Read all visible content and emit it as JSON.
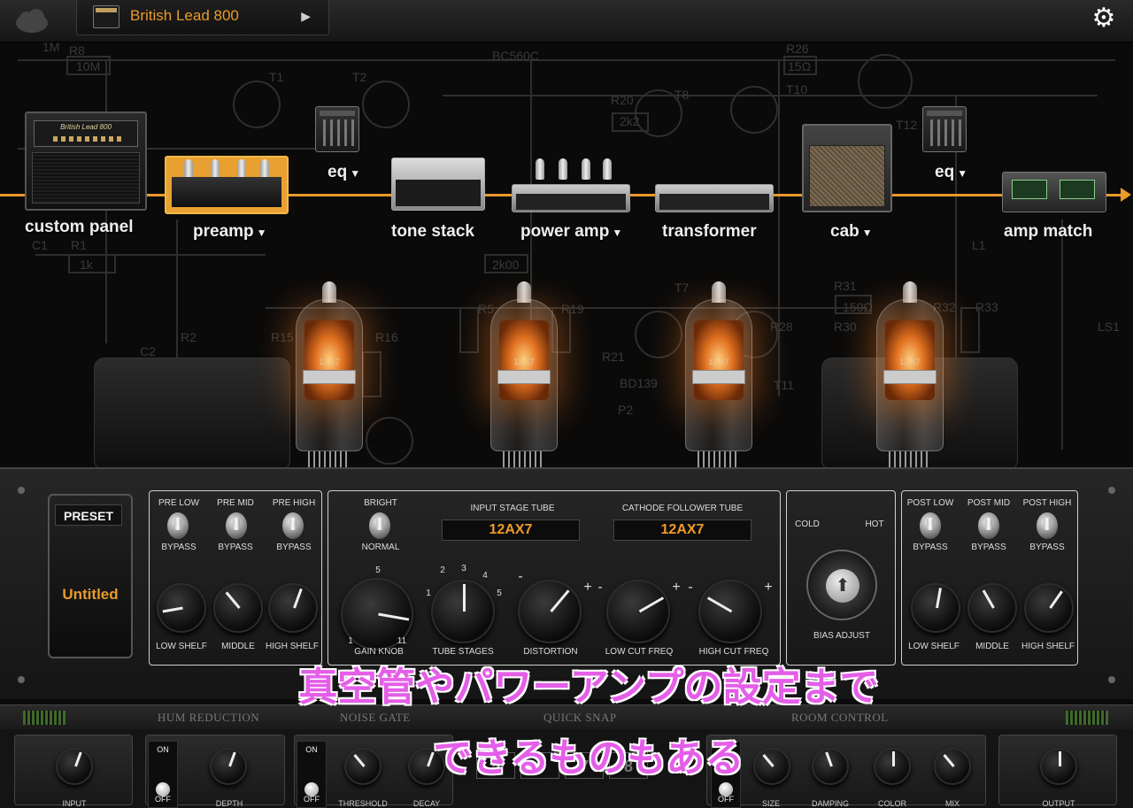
{
  "topbar": {
    "preset_name": "British Lead 800",
    "cloud_icon": "cloud-icon",
    "settings_icon": "gear-icon"
  },
  "schematic_labels": [
    "R8",
    "10M",
    "T1",
    "T2",
    "BC560C",
    "R26",
    "15Ω",
    "T10",
    "R20",
    "2k2",
    "T8",
    "C1",
    "R1",
    "1k",
    "2k00",
    "R16",
    "R15",
    "R2",
    "C2",
    "R5",
    "R19",
    "BD139",
    "R21",
    "R31",
    "150Ω",
    "R32",
    "R33",
    "R28",
    "R30",
    "P2",
    "T7",
    "T11",
    "T12",
    "L1",
    "LS1",
    "1M"
  ],
  "chain": {
    "modules": [
      {
        "label": "custom panel",
        "dropdown": false
      },
      {
        "label": "preamp",
        "dropdown": true
      },
      {
        "label": "eq",
        "dropdown": true
      },
      {
        "label": "tone stack",
        "dropdown": false
      },
      {
        "label": "power amp",
        "dropdown": true
      },
      {
        "label": "transformer",
        "dropdown": false
      },
      {
        "label": "cab",
        "dropdown": true
      },
      {
        "label": "eq",
        "dropdown": true
      },
      {
        "label": "amp match",
        "dropdown": false
      }
    ],
    "custom_panel_plate": "British Lead 800",
    "accent": "#e89a2a"
  },
  "tubes": {
    "label": "12 X7"
  },
  "amp_panel": {
    "preset_tag": "PRESET",
    "preset_value": "Untitled",
    "pre_eq": {
      "toggles": [
        {
          "top": "PRE LOW",
          "bottom": "BYPASS"
        },
        {
          "top": "PRE MID",
          "bottom": "BYPASS"
        },
        {
          "top": "PRE HIGH",
          "bottom": "BYPASS"
        }
      ],
      "knobs": [
        "LOW SHELF",
        "MIDDLE",
        "HIGH SHELF"
      ]
    },
    "tube_stage": {
      "bright_top": "BRIGHT",
      "bright_bottom": "NORMAL",
      "input_tube_label": "INPUT STAGE TUBE",
      "input_tube_value": "12AX7",
      "cathode_tube_label": "CATHODE FOLLOWER TUBE",
      "cathode_tube_value": "12AX7",
      "knobs": [
        "GAIN KNOB",
        "TUBE STAGES",
        "DISTORTION",
        "LOW CUT FREQ",
        "HIGH CUT FREQ"
      ],
      "gain_scale": {
        "top": "5",
        "left": "1",
        "right": "11"
      },
      "stages_scale": {
        "s1": "1",
        "s2": "2",
        "s3": "3",
        "s4": "4",
        "s5": "5"
      },
      "minus": "-",
      "plus": "+"
    },
    "bias": {
      "cold": "COLD",
      "hot": "HOT",
      "label": "BIAS ADJUST"
    },
    "post_eq": {
      "toggles": [
        {
          "top": "POST LOW",
          "bottom": "BYPASS"
        },
        {
          "top": "POST MID",
          "bottom": "BYPASS"
        },
        {
          "top": "POST HIGH",
          "bottom": "BYPASS"
        }
      ],
      "knobs": [
        "LOW SHELF",
        "MIDDLE",
        "HIGH SHELF"
      ]
    }
  },
  "caption": {
    "line1": "真空管やパワーアンプの設定まで",
    "line2": "できるものもある",
    "color": "#e45ee8"
  },
  "fx": {
    "sections": [
      "HUM REDUCTION",
      "NOISE GATE",
      "QUICK SNAP",
      "ROOM CONTROL"
    ],
    "on": "ON",
    "off": "OFF",
    "input": "INPUT",
    "depth": "DEPTH",
    "threshold": "THRESHOLD",
    "decay": "DECAY",
    "snaps": [
      "5",
      "6",
      "7",
      "8"
    ],
    "room": [
      "SIZE",
      "DAMPING",
      "COLOR",
      "MIX"
    ],
    "output": "OUTPUT"
  }
}
